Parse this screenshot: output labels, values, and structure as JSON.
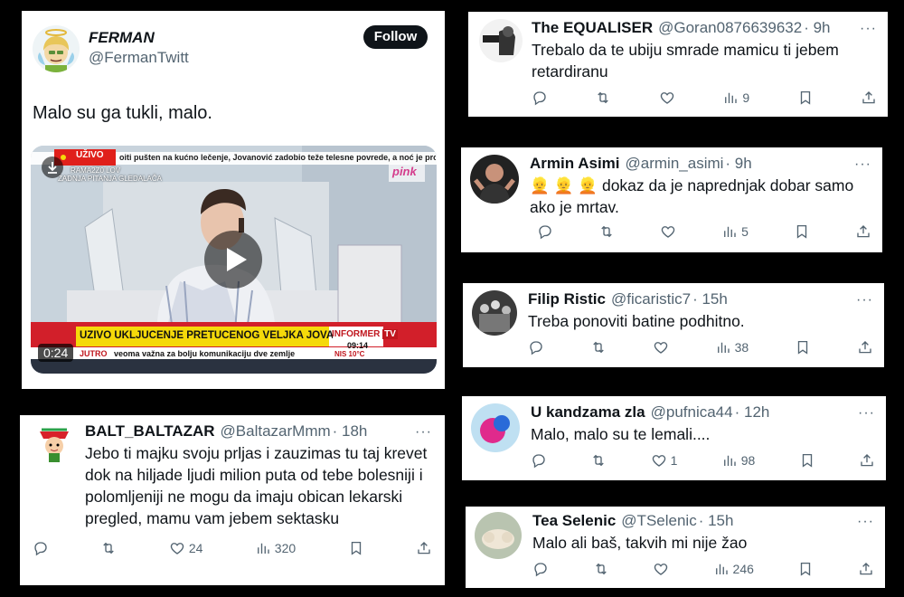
{
  "main_tweet": {
    "name": "FERMAN",
    "handle": "@FermanTwitt",
    "follow_label": "Follow",
    "text": "Malo su ga tukli, malo.",
    "video": {
      "live_badge": "UŽIVO",
      "top_ticker": "oiti pušten na kućno lečenje, Jovanović zadobio teže telesne povrede, a noć je prove",
      "program": "RAMA2Z0 LOV",
      "subtitle": "ZADNJA PITANJA GLEDALAČA",
      "channel_logo": "pink",
      "headline": "UŽIVO UKLJUČENJE PRETUČENOG VELJKA JOVANOVIĆA",
      "informer": "INFORMER",
      "tv": "TV",
      "clock": "09:14",
      "temp": "NIS 10°C",
      "bottom_ticker": "veoma važna za bolju komunikaciju dve zemlje",
      "show": "JUTRO",
      "duration": "0:24"
    }
  },
  "replies": [
    {
      "name": "The EQUALISER",
      "handle": "@Goran0876639632",
      "time": "· 9h",
      "text": "Trebalo da te ubiju smrade mamicu ti jebem retardiranu",
      "likes": "",
      "views": "9"
    },
    {
      "name": "Armin Asimi",
      "handle": "@armin_asimi",
      "time": "· 9h",
      "emoji": "👱 👱 👱",
      "text": "dokaz da je naprednjak dobar samo ako je mrtav.",
      "likes": "",
      "views": "5"
    },
    {
      "name": "Filip Ristic",
      "handle": "@ficaristic7",
      "time": "· 15h",
      "text": "Treba ponoviti batine podhitno.",
      "likes": "",
      "views": "38"
    },
    {
      "name": "U kandzama zla",
      "handle": "@pufnica44",
      "time": "· 12h",
      "text": "Malo, malo su te lemali....",
      "likes": "1",
      "views": "98"
    },
    {
      "name": "Tea Selenic",
      "handle": "@TSelenic",
      "time": "· 15h",
      "text": "Malo ali baš, takvih mi nije žao",
      "likes": "",
      "views": "246"
    },
    {
      "name": "BALT_BALTAZAR",
      "handle": "@BaltazarMmm",
      "time": "· 18h",
      "text": "Jebo ti majku svoju prljas i zauzimas tu taj krevet dok na hiljade ljudi  milion puta od tebe bolesniji i polomljeniji ne mogu da imaju obican lekarski pregled, mamu vam jebem sektasku",
      "likes": "24",
      "views": "320"
    }
  ],
  "more_label": "···",
  "colors": {
    "text": "#0f1419",
    "secondary": "#536471",
    "live_red": "#e0201b",
    "ticker_yellow": "#f5d90a"
  }
}
